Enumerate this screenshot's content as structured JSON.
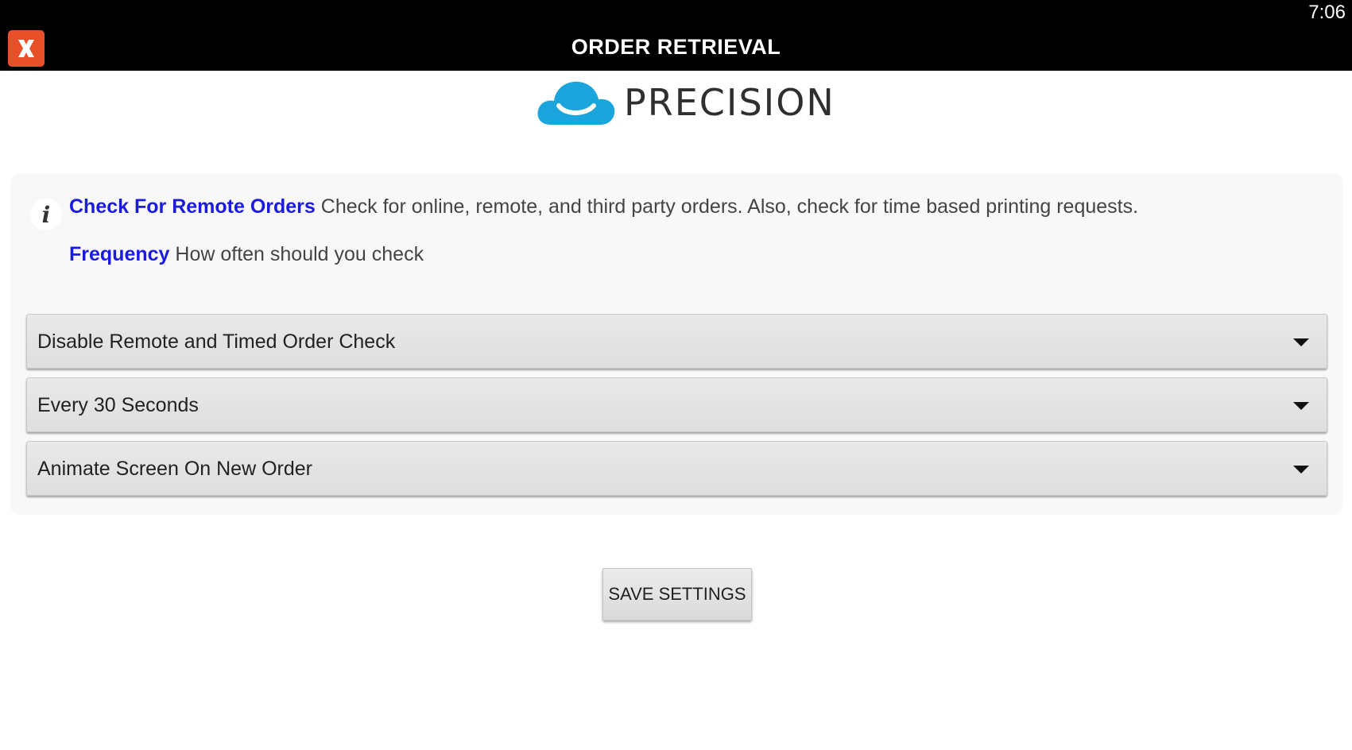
{
  "status_bar": {
    "time": "7:06"
  },
  "header": {
    "title": "ORDER RETRIEVAL",
    "close_icon": "close-icon",
    "close_color": "#e8502a"
  },
  "logo": {
    "text": "PRECISION",
    "cloud_color": "#1aa5dc"
  },
  "info": {
    "icon": "info-icon",
    "items": [
      {
        "label": "Check For Remote Orders",
        "description": "Check for online, remote, and third party orders. Also, check for time based printing requests."
      },
      {
        "label": "Frequency",
        "description": "How often should you check"
      }
    ],
    "label_color": "#1a1ae0"
  },
  "selects": [
    {
      "value": "Disable Remote and Timed Order Check",
      "icon": "chevron-down-icon"
    },
    {
      "value": "Every 30 Seconds",
      "icon": "chevron-down-icon"
    },
    {
      "value": "Animate Screen On New Order",
      "icon": "chevron-down-icon"
    }
  ],
  "save_button": {
    "label": "SAVE SETTINGS"
  }
}
